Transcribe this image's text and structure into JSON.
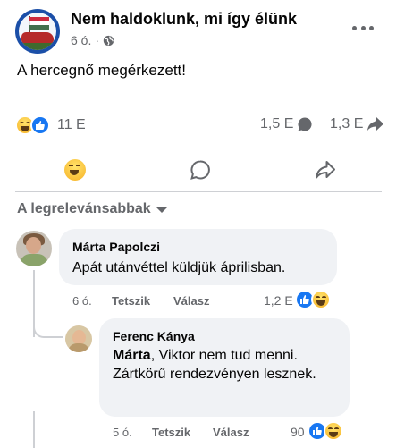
{
  "post": {
    "page_name": "Nem haldoklunk, mi így élünk",
    "time": "6 ó.",
    "privacy_icon": "globe-icon",
    "text": "A hercegnő megérkezett!"
  },
  "stats": {
    "reactions_count": "11 E",
    "reaction_icons": [
      "haha-emoji-icon",
      "like-icon"
    ],
    "comments_count": "1,5 E",
    "shares_count": "1,3 E"
  },
  "actions": {
    "react_icon": "haha-emoji-icon",
    "comment_icon": "comment-icon",
    "share_icon": "share-icon"
  },
  "sort_label": "A legrelevánsabbak",
  "comments": [
    {
      "author": "Márta Papolczi",
      "text": "Apát utánvéttel küldjük áprilisban.",
      "time": "6 ó.",
      "like_label": "Tetszik",
      "reply_label": "Válasz",
      "reactions_count": "1,2 E"
    },
    {
      "author": "Ferenc Kánya",
      "mention": "Márta",
      "text": ", Viktor nem tud menni. Zártkörű rendezvényen lesznek.",
      "time": "5 ó.",
      "like_label": "Tetszik",
      "reply_label": "Válasz",
      "reactions_count": "90"
    }
  ],
  "colors": {
    "accent": "#1877f2",
    "secondary_text": "#65676b",
    "bubble": "#f0f2f5"
  }
}
